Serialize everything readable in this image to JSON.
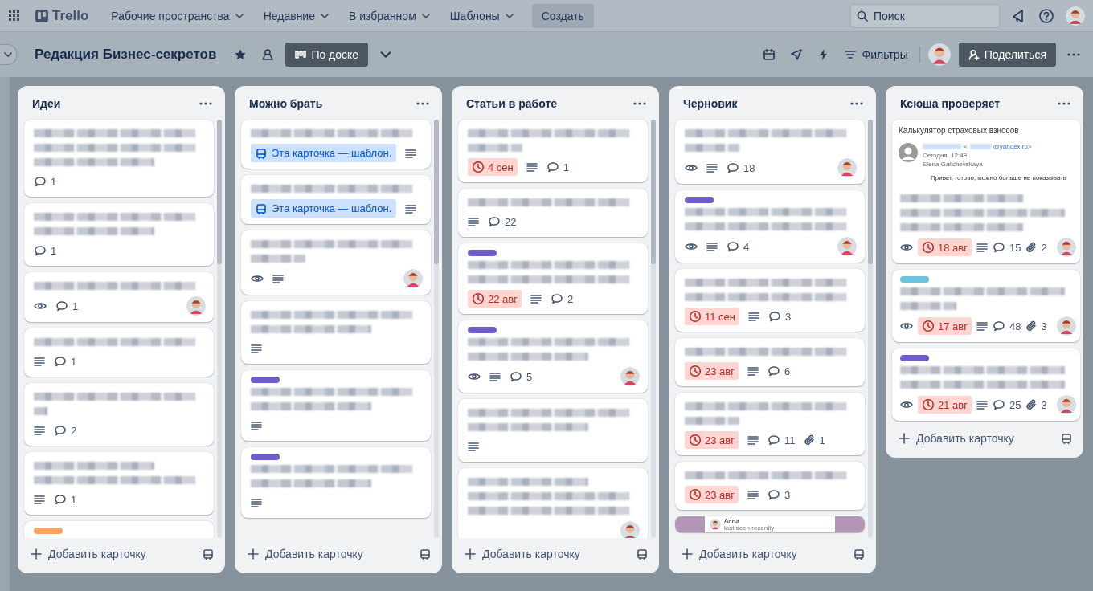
{
  "top_nav": {
    "app_name": "Trello",
    "menus": [
      {
        "label": "Рабочие пространства"
      },
      {
        "label": "Недавние"
      },
      {
        "label": "В избранном"
      },
      {
        "label": "Шаблоны"
      }
    ],
    "create_button": "Создать",
    "search": {
      "placeholder": "Поиск"
    }
  },
  "board_header": {
    "title": "Редакция Бизнес-секретов",
    "starred": true,
    "view_button": "По доске",
    "filters_button": "Фильтры",
    "share_button": "Поделиться"
  },
  "lists": [
    {
      "title": "Идеи",
      "add_card": "Добавить карточку",
      "cards": [
        {
          "blurred_title": [
            {
              "kind": "long"
            },
            {
              "kind": "long"
            },
            {
              "kind": "medium"
            }
          ],
          "comments": "1"
        },
        {
          "blurred_title": [
            {
              "kind": "long"
            },
            {
              "kind": "medium"
            }
          ],
          "comments": "1"
        },
        {
          "blurred_title": [
            {
              "kind": "long"
            }
          ],
          "watching": true,
          "comments": "1",
          "member": true
        },
        {
          "blurred_title": [
            {
              "kind": "long"
            }
          ],
          "description": true,
          "comments": "1"
        },
        {
          "blurred_title": [
            {
              "kind": "long"
            },
            {
              "kind": "tiny"
            }
          ],
          "description": true,
          "comments": "2"
        },
        {
          "blurred_title": [
            {
              "kind": "medium"
            },
            {
              "kind": "long"
            }
          ],
          "description": true,
          "comments": "1"
        },
        {
          "color": "#fea362"
        }
      ]
    },
    {
      "title": "Можно брать",
      "add_card": "Добавить карточку",
      "cards": [
        {
          "blurred_title": [
            {
              "kind": "long"
            }
          ],
          "template": "Эта карточка — шаблон.",
          "description": true
        },
        {
          "blurred_title": [
            {
              "kind": "long"
            }
          ],
          "template": "Эта карточка — шаблон.",
          "description": true
        },
        {
          "blurred_title": [
            {
              "kind": "long"
            },
            {
              "kind": "short"
            }
          ],
          "watching": true,
          "description": true,
          "member": true
        },
        {
          "blurred_title": [
            {
              "kind": "long"
            },
            {
              "kind": "medium"
            }
          ],
          "description": true
        },
        {
          "color": "#6e5dc6",
          "blurred_title": [
            {
              "kind": "long"
            },
            {
              "kind": "medium"
            }
          ],
          "description": true
        },
        {
          "color": "#6e5dc6",
          "blurred_title": [
            {
              "kind": "long"
            },
            {
              "kind": "medium"
            }
          ],
          "description": true
        }
      ]
    },
    {
      "title": "Статьи в работе",
      "add_card": "Добавить карточку",
      "cards": [
        {
          "blurred_title": [
            {
              "kind": "long"
            },
            {
              "kind": "short"
            }
          ],
          "due": "4 сен",
          "overdue": true,
          "description": true,
          "comments": "1"
        },
        {
          "blurred_title": [
            {
              "kind": "long"
            }
          ],
          "description": true,
          "comments": "22"
        },
        {
          "color": "#6e5dc6",
          "blurred_title": [
            {
              "kind": "long"
            },
            {
              "kind": "long"
            }
          ],
          "due": "22 авг",
          "overdue": true,
          "description": true,
          "comments": "2"
        },
        {
          "color": "#6e5dc6",
          "blurred_title": [
            {
              "kind": "long"
            },
            {
              "kind": "medium"
            }
          ],
          "watching": true,
          "description": true,
          "comments": "5",
          "member": true
        },
        {
          "blurred_title": [
            {
              "kind": "long"
            },
            {
              "kind": "medium"
            }
          ],
          "description": true
        },
        {
          "blurred_title": [
            {
              "kind": "medium"
            },
            {
              "kind": "long"
            },
            {
              "kind": "long"
            }
          ],
          "member": true
        }
      ]
    },
    {
      "title": "Черновик",
      "add_card": "Добавить карточку",
      "cards": [
        {
          "blurred_title": [
            {
              "kind": "long"
            },
            {
              "kind": "short"
            }
          ],
          "watching": true,
          "description": true,
          "comments": "18",
          "member": true
        },
        {
          "color": "#6e5dc6",
          "blurred_title": [
            {
              "kind": "long"
            },
            {
              "kind": "long"
            }
          ],
          "watching": true,
          "description": true,
          "comments": "4",
          "member": true
        },
        {
          "blurred_title": [
            {
              "kind": "long"
            },
            {
              "kind": "long"
            }
          ],
          "due": "11 сен",
          "overdue": true,
          "description": true,
          "comments": "3"
        },
        {
          "blurred_title": [
            {
              "kind": "long"
            }
          ],
          "due": "23 авг",
          "overdue": true,
          "description": true,
          "comments": "6"
        },
        {
          "blurred_title": [
            {
              "kind": "long"
            },
            {
              "kind": "short"
            }
          ],
          "due": "23 авг",
          "overdue": true,
          "description": true,
          "comments": "11",
          "attachments": "1"
        },
        {
          "blurred_title": [
            {
              "kind": "long"
            }
          ],
          "due": "23 авг",
          "overdue": true,
          "description": true,
          "comments": "3"
        },
        {
          "cover": {
            "kind": "chat",
            "name": "Анна",
            "status": "last seen recently"
          }
        }
      ]
    },
    {
      "title": "Ксюша проверяет",
      "add_card": "Добавить карточку",
      "cards": [
        {
          "cover": {
            "kind": "email",
            "subject": "Калькулятор страховых взносов",
            "address_open": "<",
            "address_domain": "@yandex.ru>",
            "date": "Сегодня, 12:48",
            "recipient": "Elena Galichevskaya",
            "body": "Привет, готово, можно больше не показывать"
          },
          "blurred_title": [
            {
              "kind": "medium"
            },
            {
              "kind": "long"
            },
            {
              "kind": "medium"
            }
          ],
          "watching": true,
          "due": "18 авг",
          "overdue": true,
          "description": true,
          "comments": "15",
          "attachments": "2",
          "member": true
        },
        {
          "color": "#6cc3e0",
          "blurred_title": [
            {
              "kind": "long"
            },
            {
              "kind": "short"
            }
          ],
          "watching": true,
          "due": "17 авг",
          "overdue": true,
          "description": true,
          "comments": "48",
          "attachments": "3",
          "member": true
        },
        {
          "color": "#6e5dc6",
          "blurred_title": [
            {
              "kind": "long"
            },
            {
              "kind": "long"
            }
          ],
          "watching": true,
          "due": "21 авг",
          "overdue": true,
          "description": true,
          "comments": "25",
          "attachments": "3",
          "member": true
        }
      ]
    }
  ]
}
